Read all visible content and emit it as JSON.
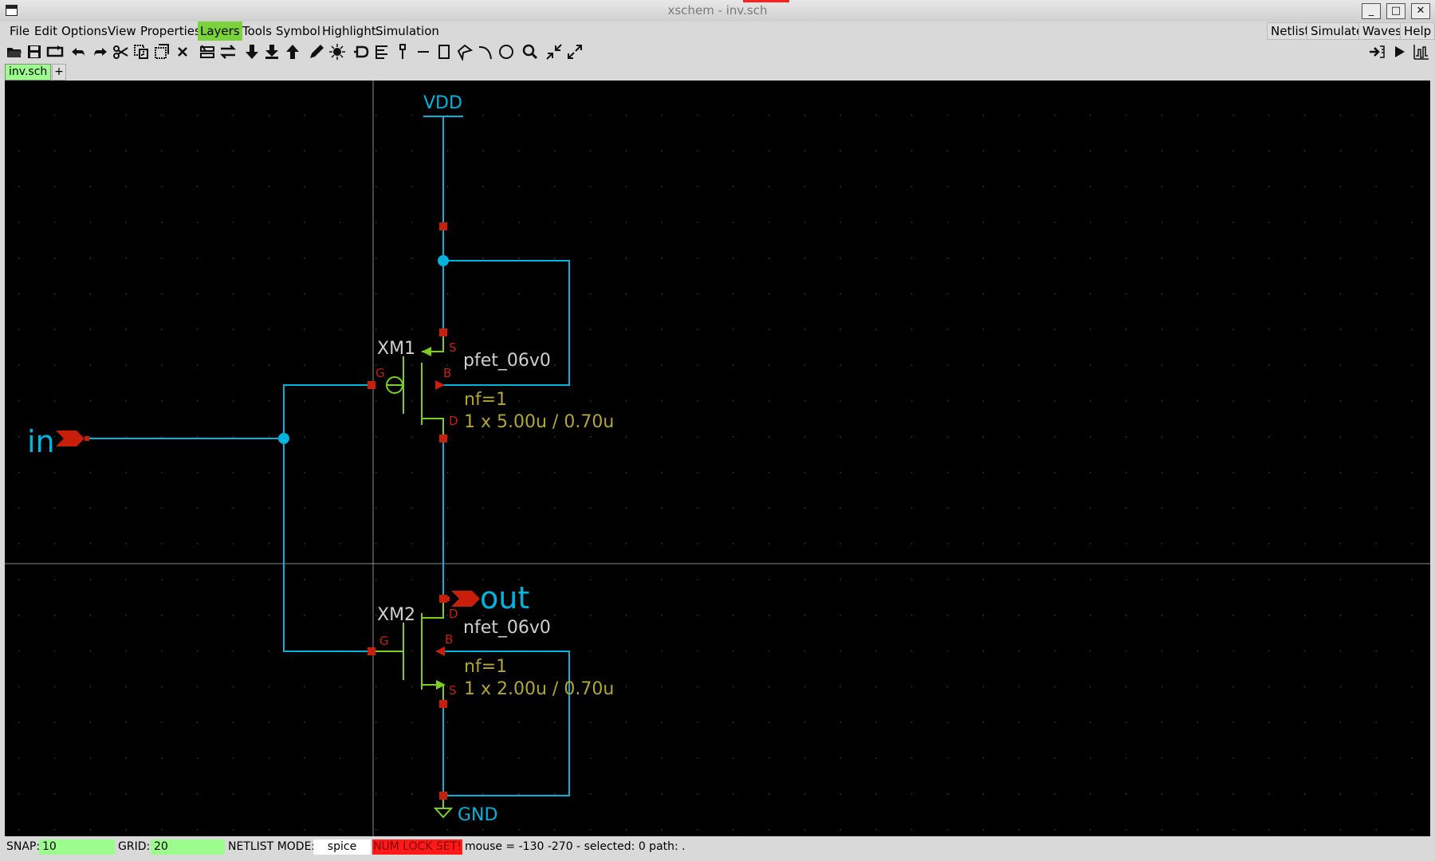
{
  "window": {
    "title": "xschem - inv.sch",
    "app_icon": "app-window-icon"
  },
  "window_controls": [
    "_",
    "□",
    "✕"
  ],
  "menubar": {
    "items": [
      "File",
      "Edit",
      "Options",
      "View",
      "Properties",
      "Layers",
      "Tools",
      "Symbol",
      "Highlight",
      "Simulation"
    ],
    "active": "Layers",
    "right_buttons": [
      "Netlist",
      "Simulate",
      "Waves",
      "Help"
    ]
  },
  "toolbar": {
    "icons": [
      "open-icon",
      "save-icon",
      "reload-icon",
      "undo-icon",
      "redo-icon",
      "cut-icon",
      "copy-icon",
      "duplicate-icon",
      "delete-icon",
      "select-bus-icon",
      "swap-icon",
      "push-down-icon",
      "push-down-symbol-icon",
      "go-up-icon",
      "pencil-icon",
      "highlight-icon",
      "insert-symbol-icon",
      "place-text-icon",
      "place-pin-icon",
      "line-icon",
      "rect-icon",
      "polygon-icon",
      "arc-icon",
      "circle-icon",
      "zoom-icon",
      "zoom-full-icon",
      "zoom-fit-icon"
    ],
    "right_icons": [
      "netlist-arrow-icon",
      "run-icon",
      "waves-icon"
    ]
  },
  "tabs": {
    "items": [
      "inv.sch"
    ],
    "add_label": "+"
  },
  "schematic": {
    "vdd_label": "VDD",
    "gnd_label": "GND",
    "in_label": "in",
    "out_label": "out",
    "xm1": {
      "name": "XM1",
      "model": "pfet_06v0",
      "nf": "nf=1",
      "size": "1 x 5.00u / 0.70u"
    },
    "xm2": {
      "name": "XM2",
      "model": "nfet_06v0",
      "nf": "nf=1",
      "size": "1 x 2.00u / 0.70u"
    },
    "pin_labels": {
      "g": "G",
      "s": "S",
      "b": "B",
      "d": "D"
    },
    "colors": {
      "wire": "#00b4dc",
      "device": "#7bd01e",
      "pin": "#c81e0a",
      "attr": "#b4a632",
      "text": "#cfcfcf",
      "background": "#000000"
    }
  },
  "statusbar": {
    "snap_label": "SNAP:",
    "snap_value": "10",
    "grid_label": "GRID:",
    "grid_value": "20",
    "netlist_label": "NETLIST MODE:",
    "netlist_value": "spice",
    "numlock": "NUM LOCK SET!",
    "mouse_info": "mouse = -130 -270 - selected: 0 path: ."
  }
}
